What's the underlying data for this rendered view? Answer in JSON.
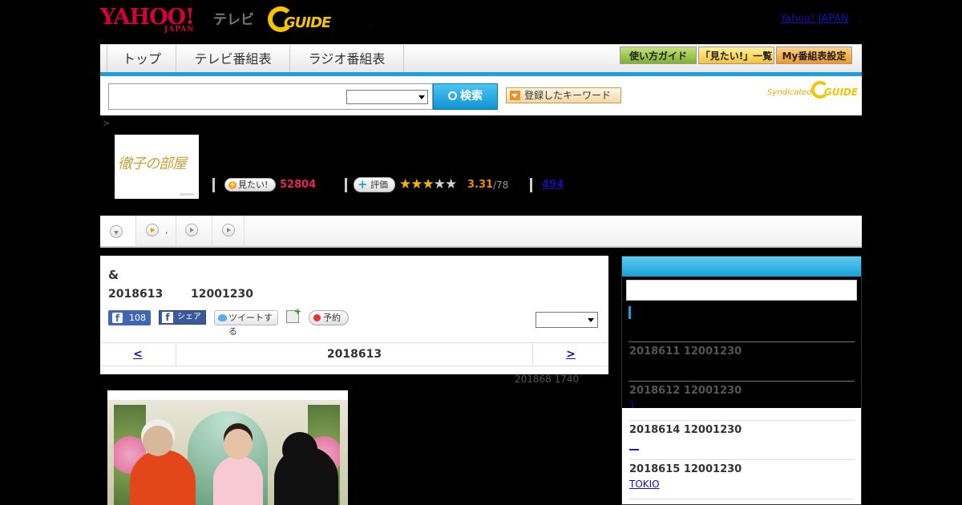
{
  "header": {
    "logo_text": "YAHOO!",
    "logo_sub": "JAPAN",
    "tv_label": "テレビ",
    "gguide_text": "GUIDE",
    "dot_link": ",",
    "yahoo_japan_link": "Yahoo! JAPAN",
    "yahoo_japan_link2": ","
  },
  "nav": {
    "tabs": [
      {
        "label": "トップ"
      },
      {
        "label": "テレビ番組表"
      },
      {
        "label": "ラジオ番組表"
      }
    ],
    "buttons": [
      {
        "label": "使い方ガイド",
        "color": "#7db32f"
      },
      {
        "label": "「見たい!」一覧",
        "color": "#f6c339"
      },
      {
        "label": "My番組表設定",
        "color": "#f29722"
      }
    ],
    "accent_color": "#1ba0d8"
  },
  "search": {
    "input_value": "",
    "select_value": "",
    "button_label": "検索",
    "keyword_button_label": "登録したキーワード",
    "syndicated_label": "Syndicated",
    "syndicated_logo": "GUIDE"
  },
  "breadcrumb": ">",
  "program": {
    "thumbnail_title": "徹子の部屋",
    "mitai_label": "見たい!",
    "mitai_count": "52804",
    "hyoka_label": "評価",
    "stars": {
      "filled": 3,
      "total": 5
    },
    "rating": "3.31",
    "rating_count": "/78",
    "comments_count": "494"
  },
  "subtabs": [
    {
      "icon": "down-arrow-icon"
    },
    {
      "icon": "play-icon",
      "label": ","
    },
    {
      "icon": "play-icon"
    },
    {
      "icon": "play-icon"
    }
  ],
  "episode": {
    "title": "&",
    "date": "2018613",
    "time": "12001230",
    "fb_like_count": "108",
    "fb_share_label": "シェア",
    "tweet_label": "ツイートする",
    "yoyaku_label": "予約",
    "select_value": "",
    "nav": {
      "prev": "<",
      "current": "2018613",
      "next": ">"
    },
    "updated": "201868  1740"
  },
  "sidebar": {
    "items": [
      {
        "date": "2018611  12001230",
        "link": ""
      },
      {
        "date": "2018612  12001230",
        "link": "1"
      },
      {
        "date": "2018614  12001230",
        "link": "__"
      },
      {
        "date": "2018615  12001230",
        "link": "TOKIO"
      }
    ]
  }
}
